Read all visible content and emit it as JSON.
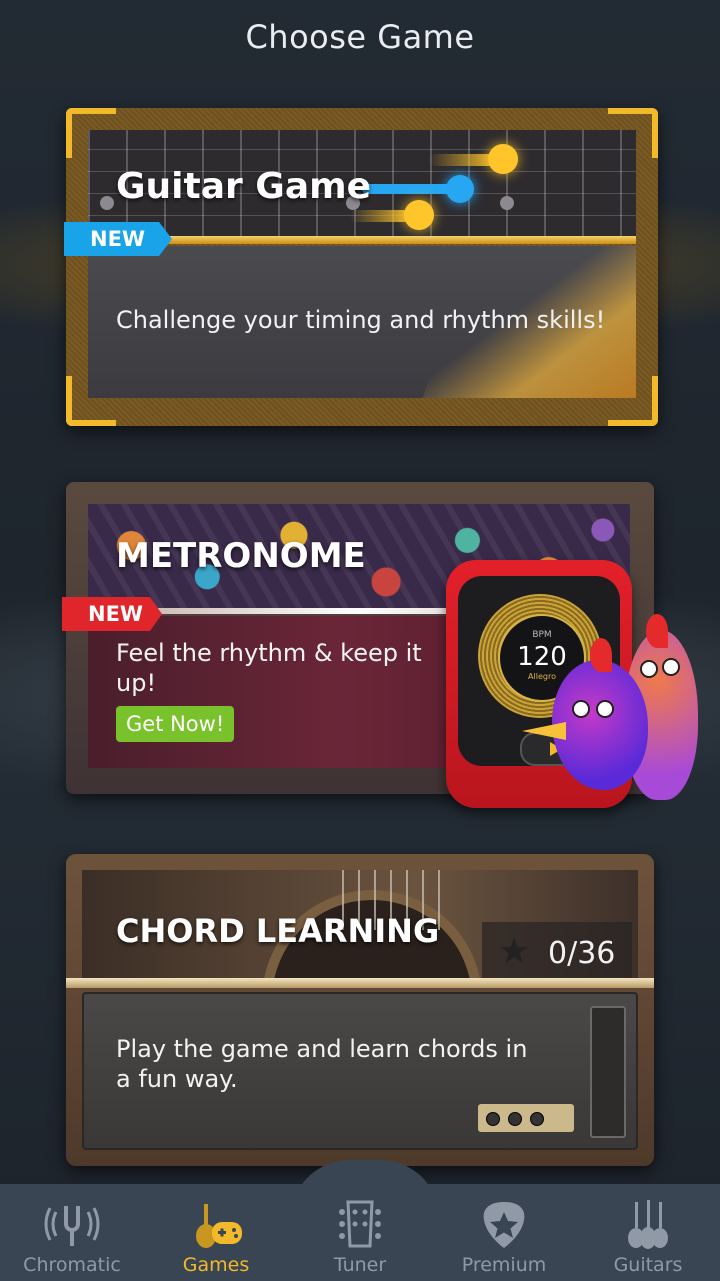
{
  "header": {
    "title": "Choose Game"
  },
  "games": {
    "guitar": {
      "title": "Guitar Game",
      "badge": "NEW",
      "description": "Challenge your timing and rhythm skills!"
    },
    "metronome": {
      "title": "METRONOME",
      "badge": "NEW",
      "description": "Feel the rhythm & keep it up!",
      "cta": "Get Now!",
      "device": {
        "bpm_label": "BPM",
        "bpm": "120",
        "tempo_word": "Allegro"
      }
    },
    "chord": {
      "title": "CHORD LEARNING",
      "progress": "0/36",
      "description": "Play the game and learn chords in a fun way."
    }
  },
  "nav": {
    "items": [
      {
        "label": "Chromatic",
        "icon": "tuning-fork-icon",
        "active": false
      },
      {
        "label": "Games",
        "icon": "guitar-gamepad-icon",
        "active": true
      },
      {
        "label": "Tuner",
        "icon": "guitar-headstock-icon",
        "active": false
      },
      {
        "label": "Premium",
        "icon": "pick-star-icon",
        "active": false
      },
      {
        "label": "Guitars",
        "icon": "guitars-icon",
        "active": false
      }
    ]
  },
  "colors": {
    "accent": "#f2b92a",
    "new_blue": "#19a3e8",
    "new_red": "#e0262a",
    "cta_green": "#7ac22c",
    "nav_bg": "#3a4553"
  }
}
